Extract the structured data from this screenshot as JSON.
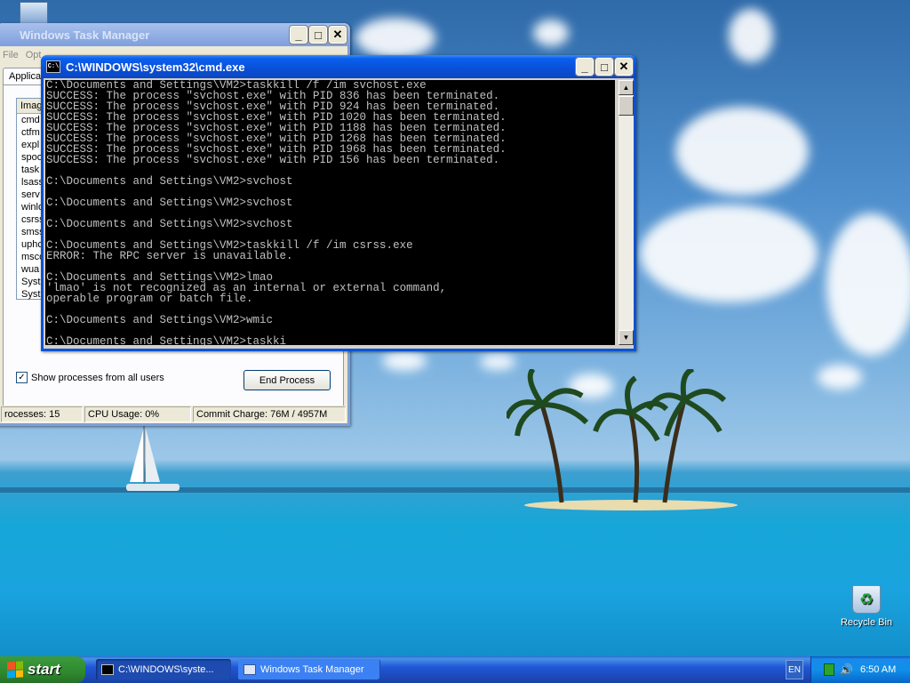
{
  "desktop": {
    "recycle_bin_label": "Recycle Bin"
  },
  "task_manager": {
    "title": "Windows Task Manager",
    "menu": [
      "File",
      "Opt"
    ],
    "tab_label": "Applicat",
    "process_header": "Imag",
    "processes": [
      "cmd",
      "ctfm",
      "expl",
      "spoo",
      "task",
      "lsass",
      "serv",
      "winlo",
      "csrss",
      "smss",
      "uphc",
      "msco",
      "wua",
      "Syst",
      "Syst"
    ],
    "show_all_label": "Show processes from all users",
    "show_all_checked": true,
    "end_process_label": "End Process",
    "status": {
      "processes": "rocesses: 15",
      "cpu": "CPU Usage: 0%",
      "commit": "Commit Charge: 76M / 4957M"
    }
  },
  "cmd": {
    "title": "C:\\WINDOWS\\system32\\cmd.exe",
    "icon_text": "C:\\",
    "lines": [
      "C:\\Documents and Settings\\VM2>taskkill /f /im svchost.exe",
      "SUCCESS: The process \"svchost.exe\" with PID 836 has been terminated.",
      "SUCCESS: The process \"svchost.exe\" with PID 924 has been terminated.",
      "SUCCESS: The process \"svchost.exe\" with PID 1020 has been terminated.",
      "SUCCESS: The process \"svchost.exe\" with PID 1188 has been terminated.",
      "SUCCESS: The process \"svchost.exe\" with PID 1268 has been terminated.",
      "SUCCESS: The process \"svchost.exe\" with PID 1968 has been terminated.",
      "SUCCESS: The process \"svchost.exe\" with PID 156 has been terminated.",
      "",
      "C:\\Documents and Settings\\VM2>svchost",
      "",
      "C:\\Documents and Settings\\VM2>svchost",
      "",
      "C:\\Documents and Settings\\VM2>svchost",
      "",
      "C:\\Documents and Settings\\VM2>taskkill /f /im csrss.exe",
      "ERROR: The RPC server is unavailable.",
      "",
      "C:\\Documents and Settings\\VM2>lmao",
      "'lmao' is not recognized as an internal or external command,",
      "operable program or batch file.",
      "",
      "C:\\Documents and Settings\\VM2>wmic",
      "",
      "C:\\Documents and Settings\\VM2>taskki"
    ]
  },
  "taskbar": {
    "start_label": "start",
    "buttons": [
      {
        "label": "C:\\WINDOWS\\syste...",
        "active": true
      },
      {
        "label": "Windows Task Manager",
        "active": false
      }
    ],
    "language": "EN",
    "clock": "6:50 AM"
  },
  "colors": {
    "console_bg": "#000000",
    "console_text": "#c0c0c0",
    "title_active": "#0a4fd6",
    "taskbar": "#2157d7",
    "start_green": "#3c9a3c"
  }
}
